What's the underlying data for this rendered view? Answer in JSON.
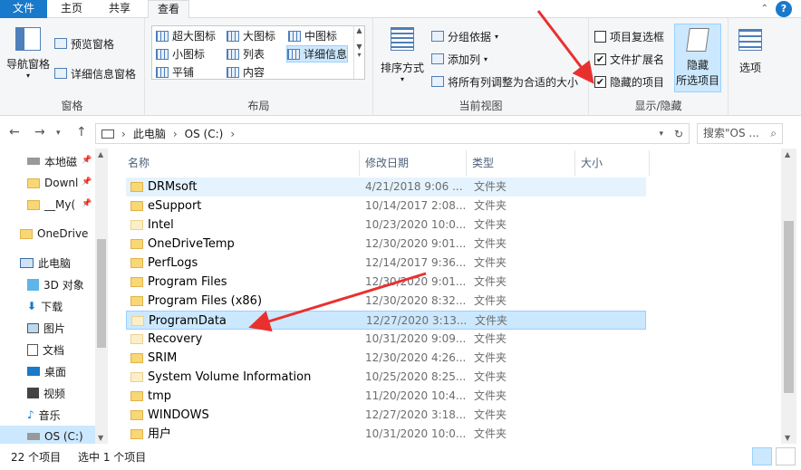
{
  "tabs": {
    "file": "文件",
    "home": "主页",
    "share": "共享",
    "view": "查看"
  },
  "ribbon": {
    "pane_group": {
      "nav_pane": "导航窗格",
      "preview_pane": "预览窗格",
      "details_pane": "详细信息窗格",
      "label": "窗格"
    },
    "layout_group": {
      "label": "布局",
      "items": [
        "超大图标",
        "大图标",
        "中图标",
        "小图标",
        "列表",
        "详细信息",
        "平铺",
        "内容"
      ]
    },
    "current_view_group": {
      "label": "当前视图",
      "sort_by": "排序方式",
      "group_by": "分组依据",
      "add_column": "添加列",
      "fit_columns": "将所有列调整为合适的大小"
    },
    "show_hide_group": {
      "label": "显示/隐藏",
      "item_checkboxes": "项目复选框",
      "file_extensions": "文件扩展名",
      "hidden_items": "隐藏的项目",
      "hide_selected_line1": "隐藏",
      "hide_selected_line2": "所选项目",
      "options": "选项"
    },
    "checkbox_marks": {
      "checked": "✔"
    }
  },
  "address": {
    "segment1": "此电脑",
    "segment2": "OS (C:)",
    "search_placeholder": "搜索\"OS ..."
  },
  "nav_pane": {
    "items": [
      {
        "label": "本地磁"
      },
      {
        "label": "Downl"
      },
      {
        "label": "__My("
      },
      {
        "label": "OneDrive"
      },
      {
        "label": "此电脑"
      },
      {
        "label": "3D 对象"
      },
      {
        "label": "下载"
      },
      {
        "label": "图片"
      },
      {
        "label": "文档"
      },
      {
        "label": "桌面"
      },
      {
        "label": "视频"
      },
      {
        "label": "音乐"
      },
      {
        "label": "OS (C:)"
      }
    ]
  },
  "columns": {
    "name": "名称",
    "date": "修改日期",
    "type": "类型",
    "size": "大小"
  },
  "rows": [
    {
      "name": "DRMsoft",
      "date": "4/21/2018 9:06 ...",
      "type": "文件夹"
    },
    {
      "name": "eSupport",
      "date": "10/14/2017 2:08...",
      "type": "文件夹"
    },
    {
      "name": "Intel",
      "date": "10/23/2020 10:0...",
      "type": "文件夹"
    },
    {
      "name": "OneDriveTemp",
      "date": "12/30/2020 9:01...",
      "type": "文件夹"
    },
    {
      "name": "PerfLogs",
      "date": "12/14/2017 9:36...",
      "type": "文件夹"
    },
    {
      "name": "Program Files",
      "date": "12/30/2020 9:01...",
      "type": "文件夹"
    },
    {
      "name": "Program Files (x86)",
      "date": "12/30/2020 8:32...",
      "type": "文件夹"
    },
    {
      "name": "ProgramData",
      "date": "12/27/2020 3:13...",
      "type": "文件夹"
    },
    {
      "name": "Recovery",
      "date": "10/31/2020 9:09...",
      "type": "文件夹"
    },
    {
      "name": "SRIM",
      "date": "12/30/2020 4:26...",
      "type": "文件夹"
    },
    {
      "name": "System Volume Information",
      "date": "10/25/2020 8:25...",
      "type": "文件夹"
    },
    {
      "name": "tmp",
      "date": "11/20/2020 10:4...",
      "type": "文件夹"
    },
    {
      "name": "WINDOWS",
      "date": "12/27/2020 3:18...",
      "type": "文件夹"
    },
    {
      "name": "用户",
      "date": "10/31/2020 10:0...",
      "type": "文件夹"
    }
  ],
  "status": {
    "count": "22 个项目",
    "selected": "选中 1 个项目"
  },
  "colors": {
    "accent": "#1979ca",
    "selection": "#cce8ff",
    "annotation_arrow": "#e8312f"
  }
}
